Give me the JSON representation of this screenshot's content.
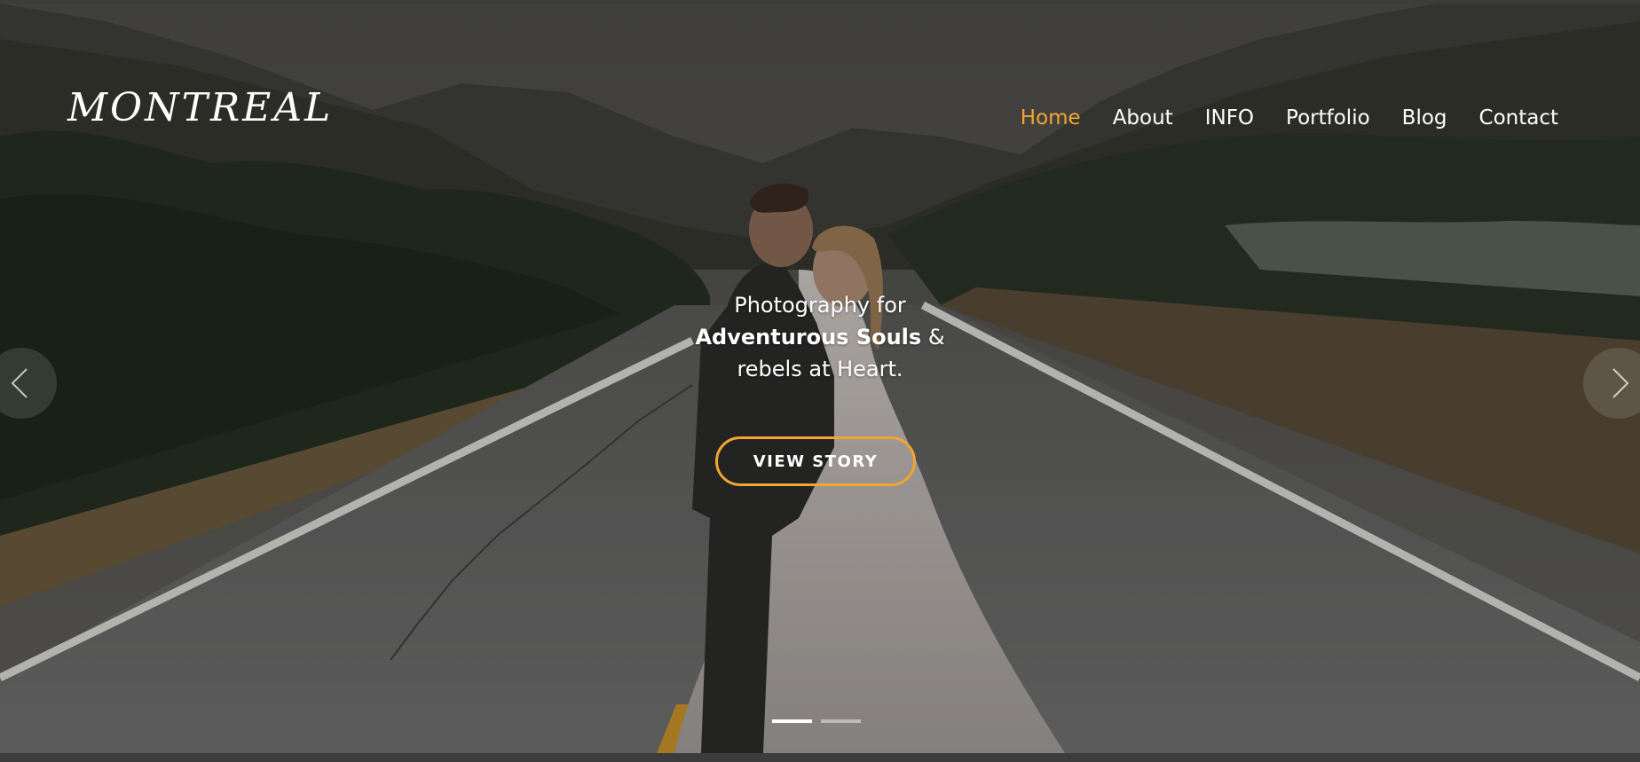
{
  "site": {
    "logo": "MONTREAL"
  },
  "nav": {
    "items": [
      {
        "label": "Home",
        "active": true
      },
      {
        "label": "About",
        "active": false
      },
      {
        "label": "INFO",
        "active": false
      },
      {
        "label": "Portfolio",
        "active": false
      },
      {
        "label": "Blog",
        "active": false
      },
      {
        "label": "Contact",
        "active": false
      }
    ],
    "active_color": "#f0a630"
  },
  "hero": {
    "line1": "Photography for",
    "line2_bold": "Adventurous Souls",
    "line2_rest": " &",
    "line3": "rebels at Heart.",
    "cta_label": "VIEW STORY",
    "accent_color": "#f0a630",
    "prev_icon": "chevron-left-icon",
    "next_icon": "chevron-right-icon",
    "slides_total": 2,
    "slide_active": 1
  }
}
